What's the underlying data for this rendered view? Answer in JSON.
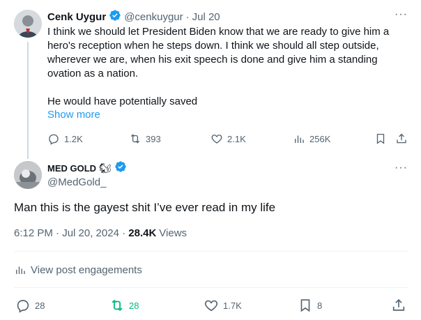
{
  "parent_tweet": {
    "display_name": "Cenk Uygur",
    "handle": "@cenkuygur",
    "separator": "·",
    "date": "Jul 20",
    "text_lines": [
      "I think we should let President Biden know that we are ready to give him a",
      "hero's reception when he steps down. I think we should all step outside,",
      "wherever we are, when his exit speech is done and give him a standing",
      "ovation as a nation."
    ],
    "text_line2": "He would have potentially saved",
    "show_more": "Show more",
    "actions": {
      "replies": "1.2K",
      "reposts": "393",
      "likes": "2.1K",
      "views": "256K"
    },
    "more_label": "···"
  },
  "reply_tweet": {
    "display_name": "MED GOLD",
    "emoji": "🐿",
    "handle": "@MedGold_",
    "text": "Man this is the gayest shit I’ve ever read in my life",
    "timestamp": "6:12 PM · Jul 20, 2024 · ",
    "views_count": "28.4K",
    "views_label": "Views",
    "engagements_label": "View post engagements",
    "actions": {
      "replies": "28",
      "reposts": "28",
      "likes": "1.7K",
      "bookmarks": "8"
    },
    "more_label": "···"
  },
  "colors": {
    "accent": "#1d9bf0",
    "repost_active": "#00ba7c",
    "muted": "#536471",
    "text": "#0f1419"
  }
}
